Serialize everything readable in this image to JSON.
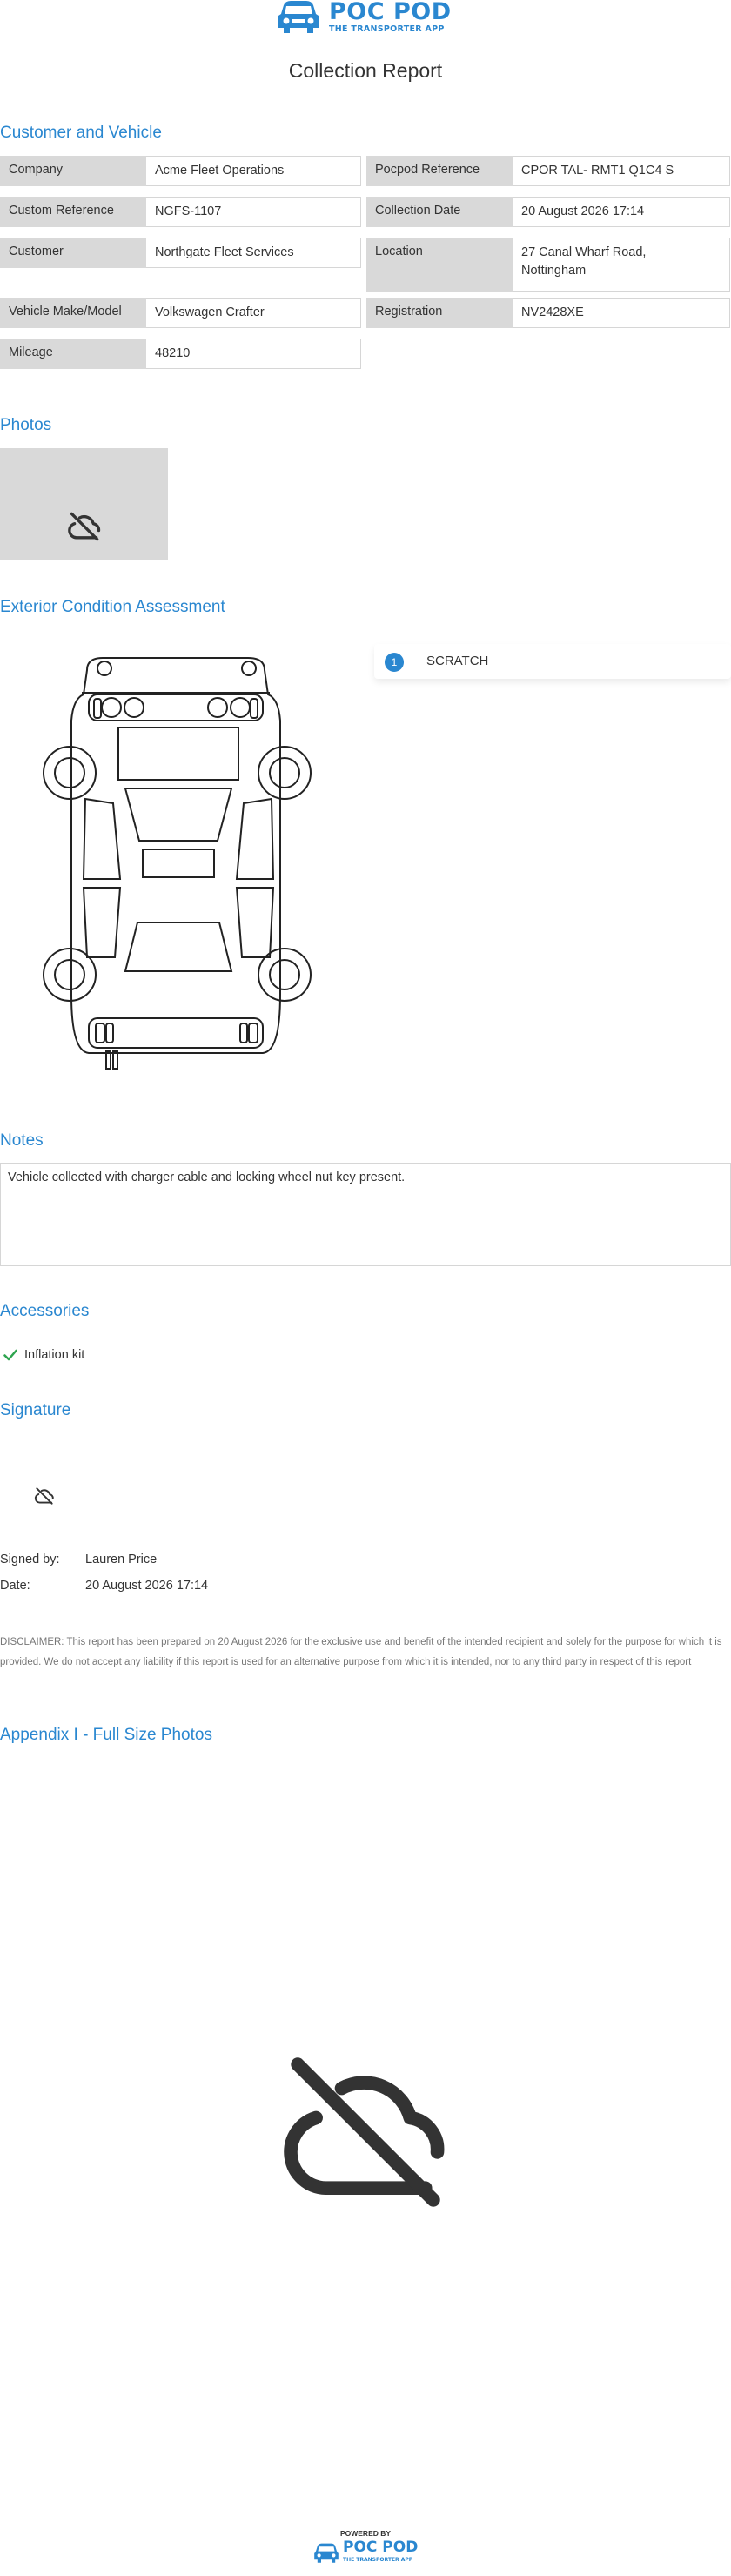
{
  "brand": {
    "name": "POC POD",
    "tagline": "THE TRANSPORTER APP",
    "color": "#2a87d0",
    "powered_by": "POWERED BY"
  },
  "report": {
    "title": "Collection Report"
  },
  "sections": {
    "customer_vehicle": "Customer and Vehicle",
    "photos": "Photos",
    "exterior": "Exterior Condition Assessment",
    "notes": "Notes",
    "accessories": "Accessories",
    "signature": "Signature",
    "appendix": "Appendix I - Full Size Photos"
  },
  "details": {
    "company_label": "Company",
    "company": "Acme Fleet Operations",
    "pocpod_ref_label": "Pocpod Reference",
    "pocpod_ref": "CPOR TAL- RMT1 Q1C4 S",
    "custom_ref_label": "Custom Reference",
    "custom_ref": "NGFS-1107",
    "collection_date_label": "Collection Date",
    "collection_date": "20 August 2026 17:14",
    "customer_label": "Customer",
    "customer": "Northgate Fleet Services",
    "location_label": "Location",
    "location_line1": "27 Canal Wharf Road,",
    "location_line2": "Nottingham",
    "make_model_label": "Vehicle Make/Model",
    "make_model": "Volkswagen Crafter",
    "registration_label": "Registration",
    "registration": "NV2428XE",
    "mileage_label": "Mileage",
    "mileage": "48210"
  },
  "damage": [
    {
      "number": "1",
      "type": "SCRATCH"
    }
  ],
  "notes": {
    "text": "Vehicle collected with charger cable and locking wheel nut key present."
  },
  "accessories": [
    {
      "label": "Inflation kit",
      "checked": true
    }
  ],
  "signature": {
    "signed_by_label": "Signed by:",
    "signed_by": "Lauren Price",
    "date_label": "Date:",
    "date": "20 August 2026 17:14"
  },
  "disclaimer": "DISCLAIMER: This report has been prepared on 20 August 2026 for the exclusive use and benefit of the intended recipient and solely for the purpose for which it is provided. We do not accept any liability if this report is used for an alternative purpose from which it is intended, nor to any third party in respect of this report",
  "icons": {
    "logo": "van-icon",
    "no_photo": "cloud-off-icon",
    "check": "check-icon"
  }
}
